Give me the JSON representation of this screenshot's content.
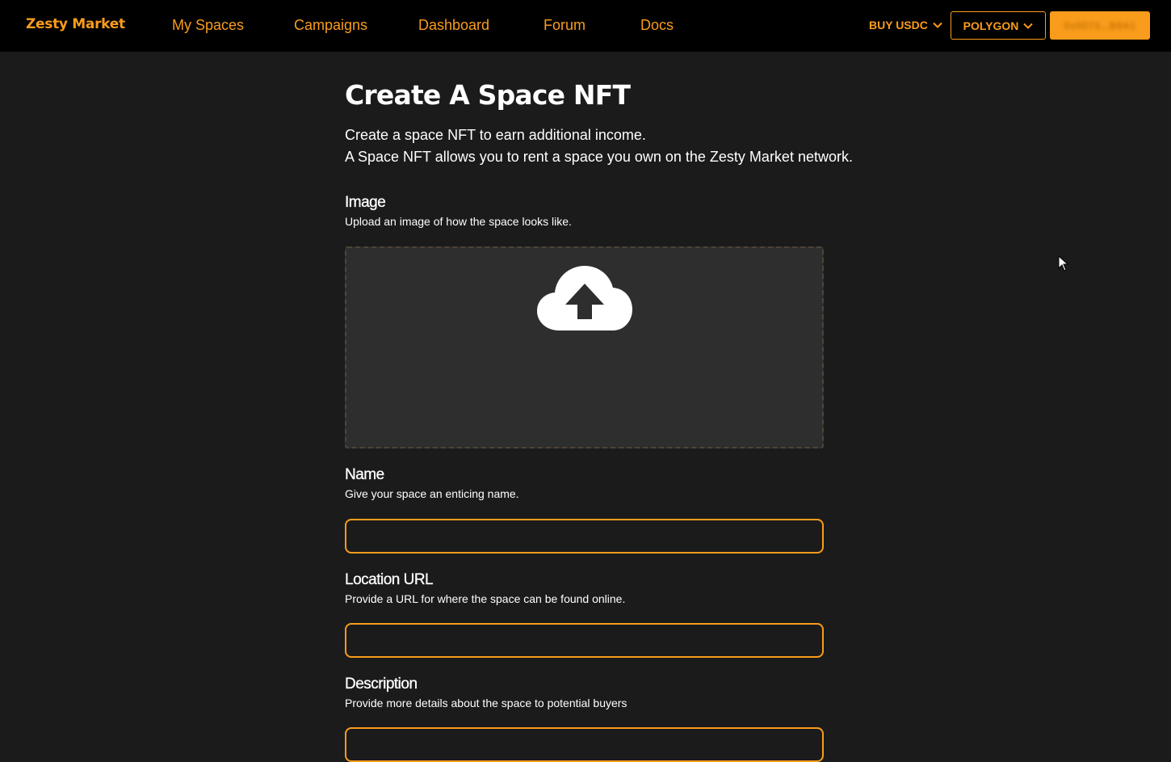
{
  "header": {
    "brand": "Zesty Market",
    "nav": [
      {
        "label": "My Spaces"
      },
      {
        "label": "Campaigns"
      },
      {
        "label": "Dashboard"
      },
      {
        "label": "Forum"
      },
      {
        "label": "Docs"
      }
    ],
    "buy_usdc_label": "BUY USDC",
    "network_label": "POLYGON",
    "wallet_label": "0x0D73...B8A1"
  },
  "page": {
    "title": "Create A Space NFT",
    "intro_line1": "Create a space NFT to earn additional income.",
    "intro_line2": "A Space NFT allows you to rent a space you own on the Zesty Market network."
  },
  "form": {
    "image": {
      "label": "Image",
      "help": "Upload an image of how the space looks like."
    },
    "name": {
      "label": "Name",
      "help": "Give your space an enticing name.",
      "value": ""
    },
    "location_url": {
      "label": "Location URL",
      "help": "Provide a URL for where the space can be found online.",
      "value": ""
    },
    "description": {
      "label": "Description",
      "help": "Provide more details about the space to potential buyers",
      "value": ""
    }
  },
  "colors": {
    "accent": "#f99c1c",
    "background": "#1b1b1b",
    "header_bg": "#000000",
    "dropzone_bg": "#2e2e2e"
  }
}
